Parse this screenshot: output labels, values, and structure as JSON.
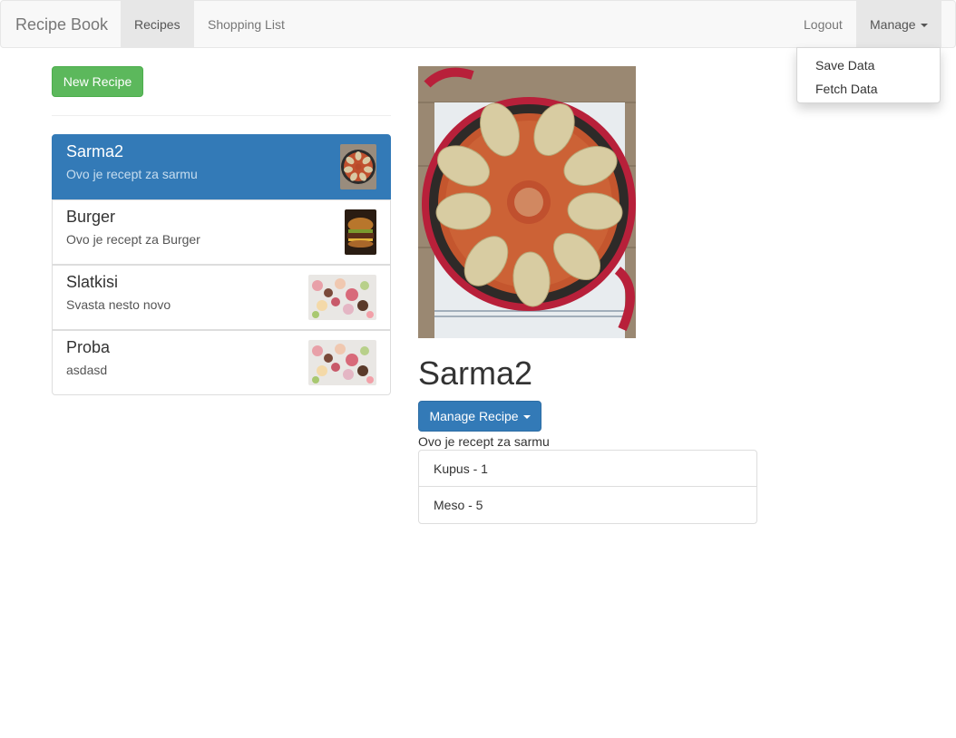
{
  "navbar": {
    "brand": "Recipe Book",
    "links": [
      {
        "label": "Recipes",
        "active": true
      },
      {
        "label": "Shopping List",
        "active": false
      }
    ],
    "logout": "Logout",
    "manage": "Manage",
    "manage_menu": [
      "Save Data",
      "Fetch Data"
    ]
  },
  "recipes": {
    "new_button": "New Recipe",
    "items": [
      {
        "name": "Sarma2",
        "description": "Ovo je recept za sarmu",
        "selected": true,
        "thumb": "sarma"
      },
      {
        "name": "Burger",
        "description": "Ovo je recept za Burger",
        "selected": false,
        "thumb": "burger"
      },
      {
        "name": "Slatkisi",
        "description": "Svasta nesto novo",
        "selected": false,
        "thumb": "sweets"
      },
      {
        "name": "Proba",
        "description": "asdasd",
        "selected": false,
        "thumb": "sweets"
      }
    ]
  },
  "detail": {
    "name": "Sarma2",
    "manage_button": "Manage Recipe",
    "description": "Ovo je recept za sarmu",
    "ingredients": [
      "Kupus - 1",
      "Meso - 5"
    ]
  },
  "colors": {
    "primary": "#337ab7",
    "success": "#5cb85c",
    "navbar_bg": "#f8f8f8"
  }
}
